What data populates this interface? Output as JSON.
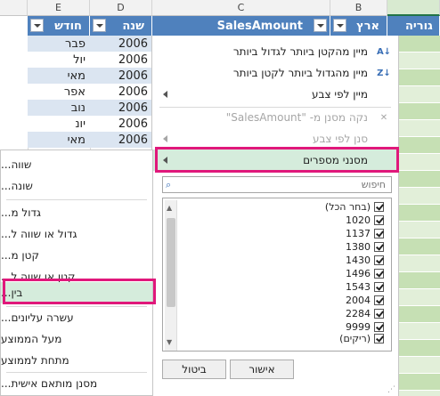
{
  "columns": {
    "letters": [
      "E",
      "D",
      "C",
      "B"
    ],
    "headers": [
      "חודש",
      "שנה",
      "SalesAmount",
      "ארץ",
      "גוריה"
    ]
  },
  "rows": [
    {
      "month": "פבר",
      "year": "2006"
    },
    {
      "month": "יול",
      "year": "2006"
    },
    {
      "month": "מאי",
      "year": "2006"
    },
    {
      "month": "אפר",
      "year": "2006"
    },
    {
      "month": "נוב",
      "year": "2006"
    },
    {
      "month": "יונ",
      "year": "2006"
    },
    {
      "month": "מאי",
      "year": "2006"
    }
  ],
  "menu": {
    "sort_asc": "מיין מהקטן ביותר לגדול ביותר",
    "sort_desc": "מיין מהגדול ביותר לקטן ביותר",
    "sort_color": "מיין לפי צבע",
    "clear_filter": "נקה מסנן מ- \"SalesAmount\"",
    "filter_color": "סנן לפי צבע",
    "number_filters": "מסנני מספרים",
    "search_placeholder": "חיפוש"
  },
  "submenu": {
    "items": [
      "שווה...",
      "שונה...",
      "גדול מ...",
      "גדול או שווה ל...",
      "קטן מ...",
      "קטן או שווה ל...",
      "בין...",
      "עשרה עליונים...",
      "מעל הממוצע",
      "מתחת לממוצע",
      "מסנן מותאם אישית..."
    ]
  },
  "filter_list": {
    "items": [
      "(בחר הכל)",
      "1020",
      "1137",
      "1380",
      "1430",
      "1496",
      "1543",
      "2004",
      "2284",
      "9999",
      "(ריקים)"
    ]
  },
  "buttons": {
    "ok": "אישור",
    "cancel": "ביטול"
  },
  "colors": {
    "header_blue": "#4f81bd",
    "band_blue": "#dbe5f1",
    "highlight_pink": "#e0187b",
    "green_col": "#c6e0b4"
  }
}
